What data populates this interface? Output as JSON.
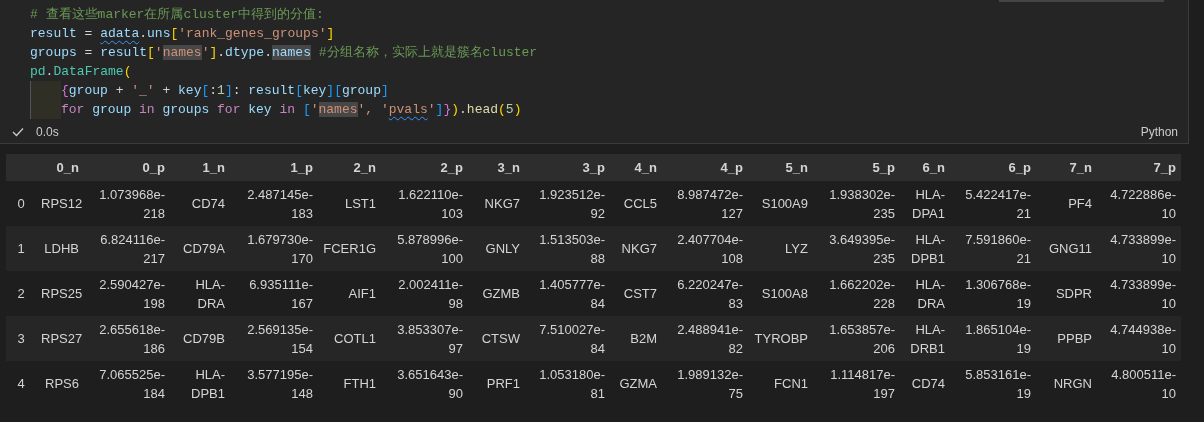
{
  "code_cell": {
    "lines": [
      {
        "tokens": [
          {
            "t": "# 查看这些marker在所属cluster中得到的分值:",
            "kind": "comment"
          }
        ]
      },
      {
        "tokens": [
          {
            "t": "result",
            "kind": "var"
          },
          {
            "t": " = ",
            "kind": "op"
          },
          {
            "t": "adata",
            "kind": "var",
            "squiggle": true
          },
          {
            "t": ".",
            "kind": "op"
          },
          {
            "t": "uns",
            "kind": "var"
          },
          {
            "t": "[",
            "kind": "br1"
          },
          {
            "t": "'rank_genes_groups'",
            "kind": "str"
          },
          {
            "t": "]",
            "kind": "br1"
          }
        ]
      },
      {
        "tokens": [
          {
            "t": "groups",
            "kind": "var"
          },
          {
            "t": " = ",
            "kind": "op"
          },
          {
            "t": "result",
            "kind": "var"
          },
          {
            "t": "[",
            "kind": "br1"
          },
          {
            "t": "'",
            "kind": "str"
          },
          {
            "t": "names",
            "kind": "str",
            "highlight": true
          },
          {
            "t": "'",
            "kind": "str"
          },
          {
            "t": "]",
            "kind": "br1"
          },
          {
            "t": ".",
            "kind": "op"
          },
          {
            "t": "dtype",
            "kind": "var"
          },
          {
            "t": ".",
            "kind": "op"
          },
          {
            "t": "names",
            "kind": "var",
            "highlight": true
          },
          {
            "t": " #分组名称，实际上就是簇名cluster",
            "kind": "comment"
          }
        ]
      },
      {
        "tokens": [
          {
            "t": "pd",
            "kind": "cls"
          },
          {
            "t": ".",
            "kind": "op"
          },
          {
            "t": "DataFrame",
            "kind": "cls"
          },
          {
            "t": "(",
            "kind": "br1"
          }
        ]
      },
      {
        "indented": true,
        "tokens": [
          {
            "t": "{",
            "kind": "br2"
          },
          {
            "t": "group",
            "kind": "var"
          },
          {
            "t": " + ",
            "kind": "op"
          },
          {
            "t": "'_'",
            "kind": "str"
          },
          {
            "t": " + ",
            "kind": "op"
          },
          {
            "t": "key",
            "kind": "var"
          },
          {
            "t": "[",
            "kind": "br3"
          },
          {
            "t": ":",
            "kind": "op"
          },
          {
            "t": "1",
            "kind": "num"
          },
          {
            "t": "]",
            "kind": "br3"
          },
          {
            "t": ": ",
            "kind": "op"
          },
          {
            "t": "result",
            "kind": "var"
          },
          {
            "t": "[",
            "kind": "br3"
          },
          {
            "t": "key",
            "kind": "var"
          },
          {
            "t": "]",
            "kind": "br3"
          },
          {
            "t": "[",
            "kind": "br3"
          },
          {
            "t": "group",
            "kind": "var"
          },
          {
            "t": "]",
            "kind": "br3"
          }
        ]
      },
      {
        "indented": true,
        "tokens": [
          {
            "t": "for ",
            "kind": "kw"
          },
          {
            "t": "group ",
            "kind": "var"
          },
          {
            "t": "in ",
            "kind": "kw"
          },
          {
            "t": "groups ",
            "kind": "var"
          },
          {
            "t": "for ",
            "kind": "kw"
          },
          {
            "t": "key ",
            "kind": "var"
          },
          {
            "t": "in ",
            "kind": "kw"
          },
          {
            "t": "[",
            "kind": "br3"
          },
          {
            "t": "'",
            "kind": "str"
          },
          {
            "t": "names",
            "kind": "str",
            "highlight": true
          },
          {
            "t": "', '",
            "kind": "str"
          },
          {
            "t": "pvals",
            "kind": "str",
            "squiggle": true
          },
          {
            "t": "'",
            "kind": "str"
          },
          {
            "t": "]",
            "kind": "br3"
          },
          {
            "t": "}",
            "kind": "br2"
          },
          {
            "t": ")",
            "kind": "br1"
          },
          {
            "t": ".",
            "kind": "op"
          },
          {
            "t": "head",
            "kind": "fn"
          },
          {
            "t": "(",
            "kind": "br1"
          },
          {
            "t": "5",
            "kind": "num"
          },
          {
            "t": ")",
            "kind": "br1"
          }
        ]
      }
    ],
    "status": {
      "succeeded": true,
      "duration": "0.0s",
      "language": "Python"
    }
  },
  "table": {
    "columns": [
      "0_n",
      "0_p",
      "1_n",
      "1_p",
      "2_n",
      "2_p",
      "3_n",
      "3_p",
      "4_n",
      "4_p",
      "5_n",
      "5_p",
      "6_n",
      "6_p",
      "7_n",
      "7_p"
    ],
    "rows": [
      {
        "index": "0",
        "cells": [
          "RPS12",
          "1.073968e-218",
          "CD74",
          "2.487145e-183",
          "LST1",
          "1.622110e-103",
          "NKG7",
          "1.923512e-92",
          "CCL5",
          "8.987472e-127",
          "S100A9",
          "1.938302e-235",
          "HLA-DPA1",
          "5.422417e-21",
          "PF4",
          "4.722886e-10"
        ]
      },
      {
        "index": "1",
        "cells": [
          "LDHB",
          "6.824116e-217",
          "CD79A",
          "1.679730e-170",
          "FCER1G",
          "5.878996e-100",
          "GNLY",
          "1.513503e-88",
          "NKG7",
          "2.407704e-108",
          "LYZ",
          "3.649395e-235",
          "HLA-DPB1",
          "7.591860e-21",
          "GNG11",
          "4.733899e-10"
        ]
      },
      {
        "index": "2",
        "cells": [
          "RPS25",
          "2.590427e-198",
          "HLA-DRA",
          "6.935111e-167",
          "AIF1",
          "2.002411e-98",
          "GZMB",
          "1.405777e-84",
          "CST7",
          "6.220247e-83",
          "S100A8",
          "1.662202e-228",
          "HLA-DRA",
          "1.306768e-19",
          "SDPR",
          "4.733899e-10"
        ]
      },
      {
        "index": "3",
        "cells": [
          "RPS27",
          "2.655618e-186",
          "CD79B",
          "2.569135e-154",
          "COTL1",
          "3.853307e-97",
          "CTSW",
          "7.510027e-84",
          "B2M",
          "2.488941e-82",
          "TYROBP",
          "1.653857e-206",
          "HLA-DRB1",
          "1.865104e-19",
          "PPBP",
          "4.744938e-10"
        ]
      },
      {
        "index": "4",
        "cells": [
          "RPS6",
          "7.065525e-184",
          "HLA-DPB1",
          "3.577195e-148",
          "FTH1",
          "3.651643e-90",
          "PRF1",
          "1.053180e-81",
          "GZMA",
          "1.989132e-75",
          "FCN1",
          "1.114817e-197",
          "CD74",
          "5.853161e-19",
          "NRGN",
          "4.800511e-10"
        ]
      }
    ]
  }
}
